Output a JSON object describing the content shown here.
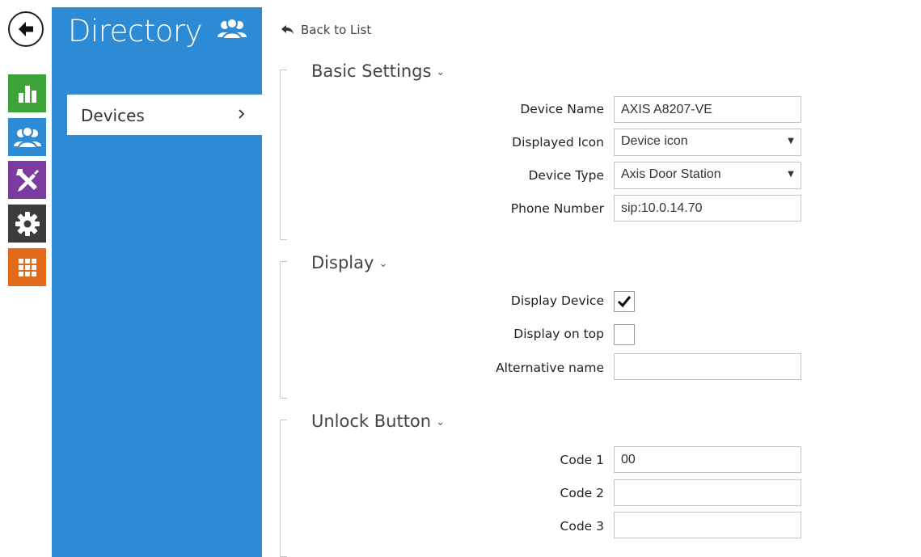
{
  "panel": {
    "title": "Directory",
    "items": [
      {
        "label": "Devices"
      }
    ]
  },
  "back_link": {
    "label": "Back to List"
  },
  "sections": {
    "basic": {
      "title": "Basic Settings",
      "device_name_label": "Device Name",
      "device_name_value": "AXIS A8207-VE",
      "displayed_icon_label": "Displayed Icon",
      "displayed_icon_value": "Device icon",
      "device_type_label": "Device Type",
      "device_type_value": "Axis Door Station",
      "phone_number_label": "Phone Number",
      "phone_number_value": "sip:10.0.14.70"
    },
    "display": {
      "title": "Display",
      "display_device_label": "Display Device",
      "display_device_checked": true,
      "display_on_top_label": "Display on top",
      "display_on_top_checked": false,
      "alternative_name_label": "Alternative name",
      "alternative_name_value": ""
    },
    "unlock": {
      "title": "Unlock Button",
      "code1_label": "Code 1",
      "code1_value": "00",
      "code2_label": "Code 2",
      "code2_value": "",
      "code3_label": "Code 3",
      "code3_value": ""
    }
  },
  "colors": {
    "panel_blue": "#2d8ad4",
    "status_green": "#3ea43a",
    "directory_blue": "#2d8ad4",
    "services_purple": "#7a3aa0",
    "system_dark": "#3c3c3c",
    "apps_orange": "#e46a1b"
  },
  "icons": [
    "back-arrow-icon",
    "bar-chart-icon",
    "users-icon",
    "tools-icon",
    "gear-icon",
    "grid-icon",
    "chevron-right-icon",
    "reply-arrow-icon",
    "chevron-down-icon",
    "checkmark-icon",
    "dropdown-arrow-icon"
  ]
}
